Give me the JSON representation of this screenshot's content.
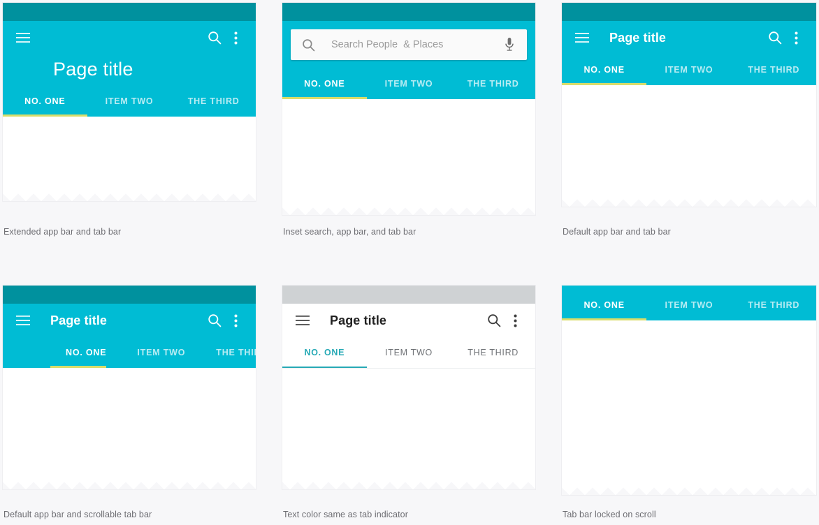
{
  "palette": {
    "status_bar": "#00919E",
    "app_bar": "#00BCD4",
    "app_bar_white": "#FFFFFF",
    "status_bar_gray": "#CFD2D4",
    "indicator_yellow": "#D9DD6A",
    "indicator_teal": "#26A9B5",
    "page_background": "#F7F7F9",
    "caption_text": "#6D6D72",
    "tab_inactive_on_color": "rgba(255,255,255,0.72)",
    "tab_inactive_on_white": "#6F7276"
  },
  "tabs": {
    "labels": [
      "NO. ONE",
      "ITEM TWO",
      "THE THIRD"
    ],
    "active_index": 0
  },
  "icons": {
    "menu": "hamburger-menu-icon",
    "search": "search-icon",
    "overflow": "more-vert-icon",
    "mic": "microphone-icon"
  },
  "cards": [
    {
      "id": "card1",
      "caption": "Extended app bar and tab bar",
      "app_bar": {
        "variant": "extended",
        "title": "Page title",
        "title_visible": true,
        "menu_label": "Menu",
        "search_label": "Search",
        "overflow_label": "More options"
      },
      "tab_bar": {
        "variant": "fixed",
        "on_white": false
      }
    },
    {
      "id": "card2",
      "caption": "Inset search, app bar, and tab bar",
      "app_bar": {
        "variant": "inset-search",
        "title": "",
        "title_visible": false,
        "search_placeholder": "Search People  & Places",
        "search_value": "",
        "mic_label": "Voice search"
      },
      "tab_bar": {
        "variant": "fixed",
        "on_white": false
      }
    },
    {
      "id": "card3",
      "caption": "Default app bar and tab bar",
      "app_bar": {
        "variant": "default",
        "title": "Page title",
        "title_visible": true,
        "menu_label": "Menu",
        "search_label": "Search",
        "overflow_label": "More options"
      },
      "tab_bar": {
        "variant": "fixed",
        "on_white": false
      }
    },
    {
      "id": "card4",
      "caption": "Default app bar and scrollable tab bar",
      "app_bar": {
        "variant": "default",
        "title": "Page title",
        "title_visible": true,
        "menu_label": "Menu",
        "search_label": "Search",
        "overflow_label": "More options"
      },
      "tab_bar": {
        "variant": "scrollable",
        "on_white": false
      }
    },
    {
      "id": "card5",
      "caption": "Text color same as tab indicator",
      "app_bar": {
        "variant": "default-white",
        "title": "Page title",
        "title_visible": true,
        "menu_label": "Menu",
        "search_label": "Search",
        "overflow_label": "More options"
      },
      "tab_bar": {
        "variant": "fixed",
        "on_white": true
      }
    },
    {
      "id": "card6",
      "caption": "Tab bar locked on scroll",
      "app_bar": {
        "variant": "none",
        "title": "",
        "title_visible": false
      },
      "tab_bar": {
        "variant": "fixed",
        "on_white": false
      }
    }
  ]
}
